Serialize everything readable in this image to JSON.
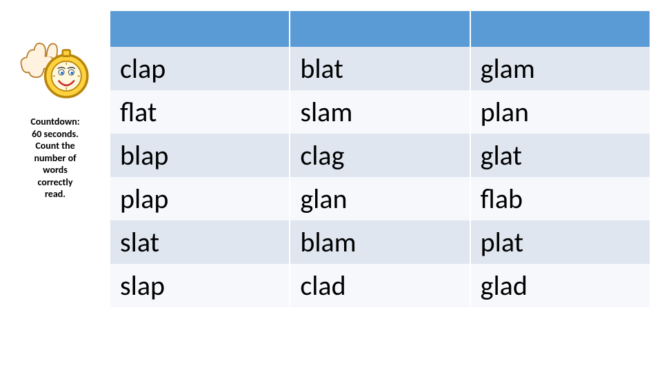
{
  "caption_line1": "Countdown:",
  "caption_line2": "60 seconds.",
  "caption_line3": "Count the",
  "caption_line4": "number of",
  "caption_line5": "words",
  "caption_line6": "correctly",
  "caption_line7": "read.",
  "table": {
    "headers": [
      "",
      "",
      ""
    ],
    "rows": [
      [
        "clap",
        "blat",
        "glam"
      ],
      [
        "flat",
        "slam",
        "plan"
      ],
      [
        "blap",
        "clag",
        "glat"
      ],
      [
        "plap",
        "glan",
        "flab"
      ],
      [
        "slat",
        "blam",
        "plat"
      ],
      [
        "slap",
        "clad",
        "glad"
      ]
    ]
  }
}
